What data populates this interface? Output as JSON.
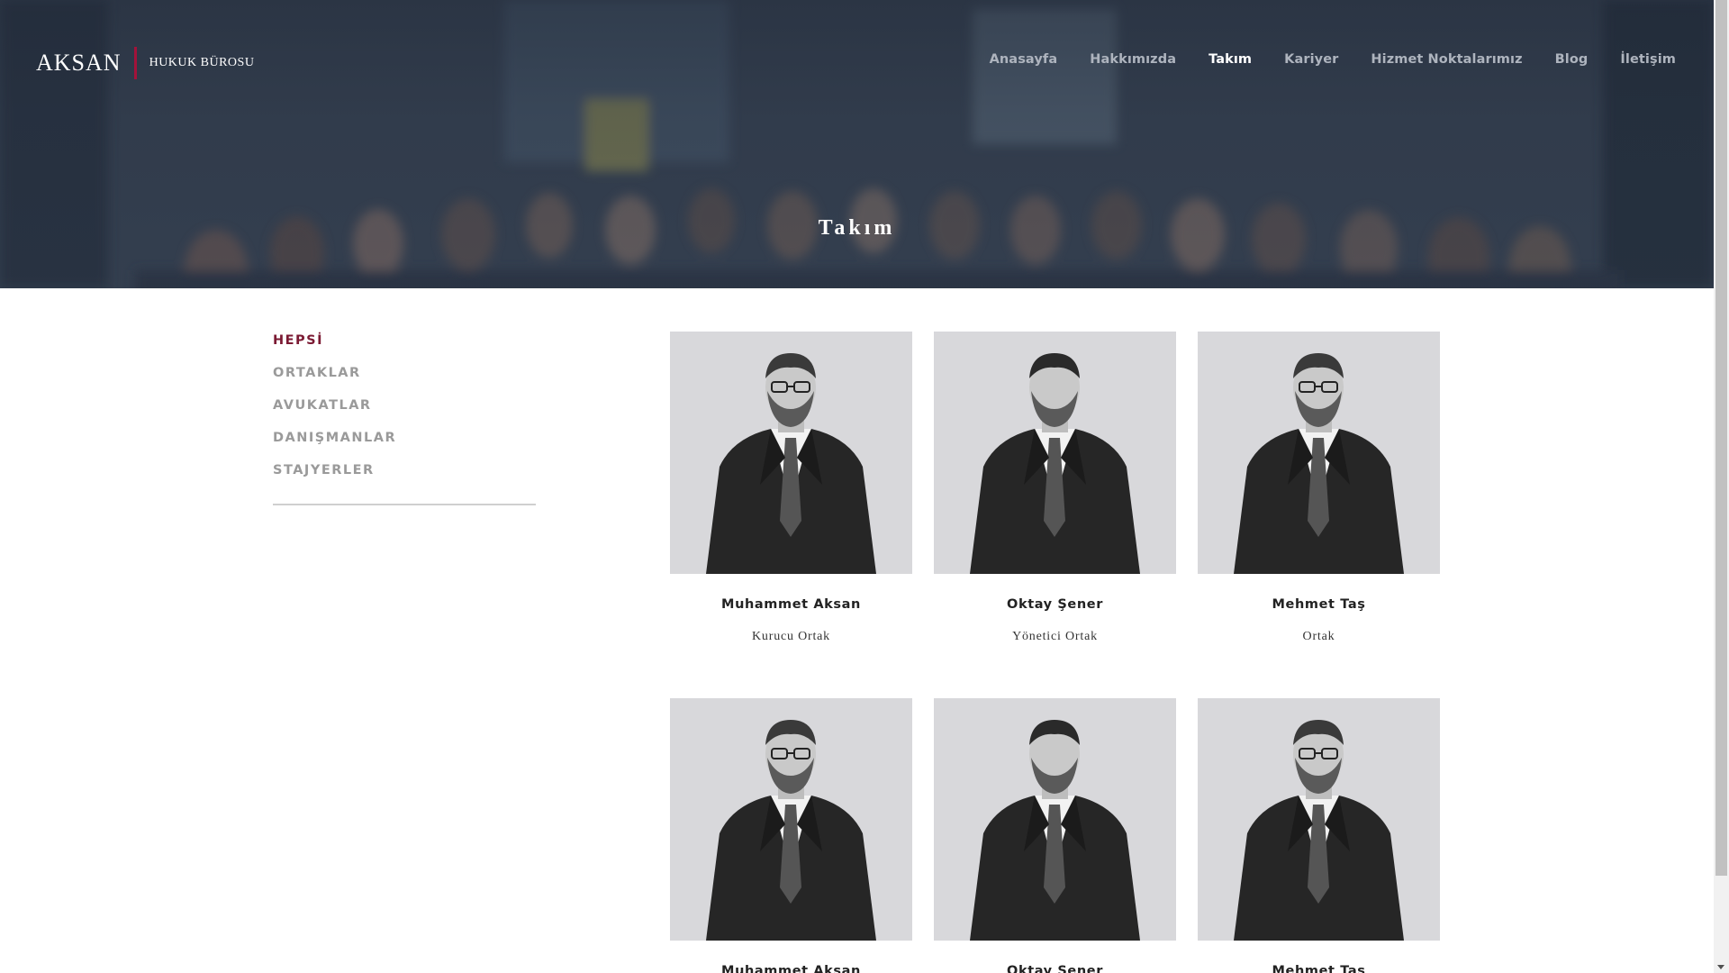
{
  "header": {
    "logo_main": "AKSAN",
    "logo_sub": "HUKUK BÜROSU",
    "nav": [
      {
        "label": "Anasayfa"
      },
      {
        "label": "Hakkımızda"
      },
      {
        "label": "Takım"
      },
      {
        "label": "Kariyer"
      },
      {
        "label": "Hizmet Noktalarımız"
      },
      {
        "label": "Blog"
      },
      {
        "label": "İletişim"
      }
    ],
    "active_nav": "Takım"
  },
  "hero": {
    "title": "Takım"
  },
  "filters": {
    "items": [
      {
        "label": "HEPSİ"
      },
      {
        "label": "ORTAKLAR"
      },
      {
        "label": "AVUKATLAR"
      },
      {
        "label": "DANIŞMANLAR"
      },
      {
        "label": "STAJYERLER"
      }
    ],
    "active": "HEPSİ"
  },
  "team": {
    "rows": [
      [
        {
          "name": "Muhammet Aksan",
          "role": "Kurucu Ortak",
          "photo": "portrait-glasses"
        },
        {
          "name": "Oktay Şener",
          "role": "Yönetici Ortak",
          "photo": "portrait-beard"
        },
        {
          "name": "Mehmet Taş",
          "role": "Ortak",
          "photo": "portrait-glasses"
        }
      ],
      [
        {
          "name": "Muhammet Aksan",
          "role": "",
          "photo": "portrait-glasses"
        },
        {
          "name": "Oktay Şener",
          "role": "",
          "photo": "portrait-beard"
        },
        {
          "name": "Mehmet Taş",
          "role": "",
          "photo": "portrait-glasses"
        }
      ]
    ]
  },
  "colors": {
    "accent": "#7b1a33",
    "logo_bar": "#a3123a",
    "nav_inactive": "#aeb4be",
    "nav_active": "#ffffff",
    "filter_inactive": "#9a9a9a"
  }
}
